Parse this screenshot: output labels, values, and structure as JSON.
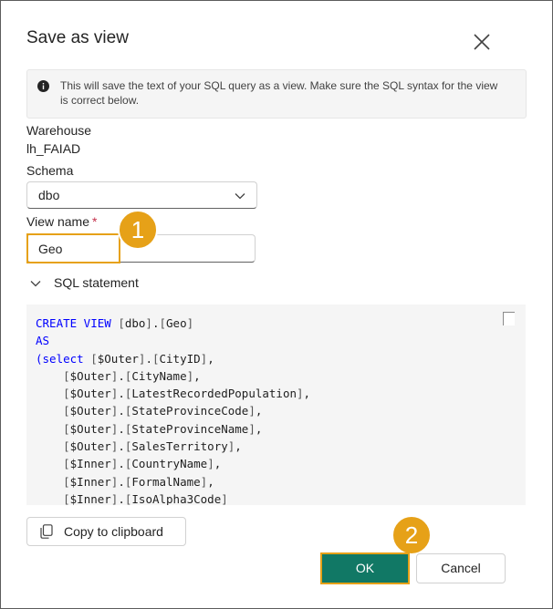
{
  "dialog": {
    "title": "Save as view",
    "info_text": "This will save the text of your SQL query as a view. Make sure the SQL syntax for the view is correct below."
  },
  "warehouse": {
    "label": "Warehouse",
    "value": "lh_FAIAD"
  },
  "schema": {
    "label": "Schema",
    "value": "dbo"
  },
  "view_name": {
    "label": "View name",
    "required_marker": "*",
    "value": "Geo"
  },
  "sql_section": {
    "label": "SQL statement",
    "lines": [
      [
        {
          "t": "CREATE VIEW ",
          "c": "kw"
        },
        {
          "t": "[",
          "c": "br"
        },
        {
          "t": "dbo",
          "c": "id"
        },
        {
          "t": "]",
          "c": "br"
        },
        {
          "t": ".",
          "c": "id"
        },
        {
          "t": "[",
          "c": "br"
        },
        {
          "t": "Geo",
          "c": "id"
        },
        {
          "t": "]",
          "c": "br"
        }
      ],
      [
        {
          "t": "AS",
          "c": "kw"
        }
      ],
      [
        {
          "t": "(select ",
          "c": "kw"
        },
        {
          "t": "[",
          "c": "br"
        },
        {
          "t": "$Outer",
          "c": "id"
        },
        {
          "t": "]",
          "c": "br"
        },
        {
          "t": ".",
          "c": "id"
        },
        {
          "t": "[",
          "c": "br"
        },
        {
          "t": "CityID",
          "c": "id"
        },
        {
          "t": "]",
          "c": "br"
        },
        {
          "t": ",",
          "c": "id"
        }
      ],
      [
        {
          "t": "    ",
          "c": "id"
        },
        {
          "t": "[",
          "c": "br"
        },
        {
          "t": "$Outer",
          "c": "id"
        },
        {
          "t": "]",
          "c": "br"
        },
        {
          "t": ".",
          "c": "id"
        },
        {
          "t": "[",
          "c": "br"
        },
        {
          "t": "CityName",
          "c": "id"
        },
        {
          "t": "]",
          "c": "br"
        },
        {
          "t": ",",
          "c": "id"
        }
      ],
      [
        {
          "t": "    ",
          "c": "id"
        },
        {
          "t": "[",
          "c": "br"
        },
        {
          "t": "$Outer",
          "c": "id"
        },
        {
          "t": "]",
          "c": "br"
        },
        {
          "t": ".",
          "c": "id"
        },
        {
          "t": "[",
          "c": "br"
        },
        {
          "t": "LatestRecordedPopulation",
          "c": "id"
        },
        {
          "t": "]",
          "c": "br"
        },
        {
          "t": ",",
          "c": "id"
        }
      ],
      [
        {
          "t": "    ",
          "c": "id"
        },
        {
          "t": "[",
          "c": "br"
        },
        {
          "t": "$Outer",
          "c": "id"
        },
        {
          "t": "]",
          "c": "br"
        },
        {
          "t": ".",
          "c": "id"
        },
        {
          "t": "[",
          "c": "br"
        },
        {
          "t": "StateProvinceCode",
          "c": "id"
        },
        {
          "t": "]",
          "c": "br"
        },
        {
          "t": ",",
          "c": "id"
        }
      ],
      [
        {
          "t": "    ",
          "c": "id"
        },
        {
          "t": "[",
          "c": "br"
        },
        {
          "t": "$Outer",
          "c": "id"
        },
        {
          "t": "]",
          "c": "br"
        },
        {
          "t": ".",
          "c": "id"
        },
        {
          "t": "[",
          "c": "br"
        },
        {
          "t": "StateProvinceName",
          "c": "id"
        },
        {
          "t": "]",
          "c": "br"
        },
        {
          "t": ",",
          "c": "id"
        }
      ],
      [
        {
          "t": "    ",
          "c": "id"
        },
        {
          "t": "[",
          "c": "br"
        },
        {
          "t": "$Outer",
          "c": "id"
        },
        {
          "t": "]",
          "c": "br"
        },
        {
          "t": ".",
          "c": "id"
        },
        {
          "t": "[",
          "c": "br"
        },
        {
          "t": "SalesTerritory",
          "c": "id"
        },
        {
          "t": "]",
          "c": "br"
        },
        {
          "t": ",",
          "c": "id"
        }
      ],
      [
        {
          "t": "    ",
          "c": "id"
        },
        {
          "t": "[",
          "c": "br"
        },
        {
          "t": "$Inner",
          "c": "id"
        },
        {
          "t": "]",
          "c": "br"
        },
        {
          "t": ".",
          "c": "id"
        },
        {
          "t": "[",
          "c": "br"
        },
        {
          "t": "CountryName",
          "c": "id"
        },
        {
          "t": "]",
          "c": "br"
        },
        {
          "t": ",",
          "c": "id"
        }
      ],
      [
        {
          "t": "    ",
          "c": "id"
        },
        {
          "t": "[",
          "c": "br"
        },
        {
          "t": "$Inner",
          "c": "id"
        },
        {
          "t": "]",
          "c": "br"
        },
        {
          "t": ".",
          "c": "id"
        },
        {
          "t": "[",
          "c": "br"
        },
        {
          "t": "FormalName",
          "c": "id"
        },
        {
          "t": "]",
          "c": "br"
        },
        {
          "t": ",",
          "c": "id"
        }
      ],
      [
        {
          "t": "    ",
          "c": "id"
        },
        {
          "t": "[",
          "c": "br"
        },
        {
          "t": "$Inner",
          "c": "id"
        },
        {
          "t": "]",
          "c": "br"
        },
        {
          "t": ".",
          "c": "id"
        },
        {
          "t": "[",
          "c": "br"
        },
        {
          "t": "IsoAlpha3Code",
          "c": "id"
        },
        {
          "t": "]",
          "c": "br"
        }
      ]
    ]
  },
  "buttons": {
    "copy": "Copy to clipboard",
    "ok": "OK",
    "cancel": "Cancel"
  },
  "callouts": {
    "one": "1",
    "two": "2"
  },
  "colors": {
    "primary": "#117865",
    "callout": "#e6a118",
    "keyword": "#0000ff",
    "required": "#c4314b"
  },
  "icons": {
    "close": "close-icon",
    "info": "info-icon",
    "dropdown": "chevron-down-icon",
    "collapse": "chevron-down-icon",
    "copy": "copy-icon"
  }
}
